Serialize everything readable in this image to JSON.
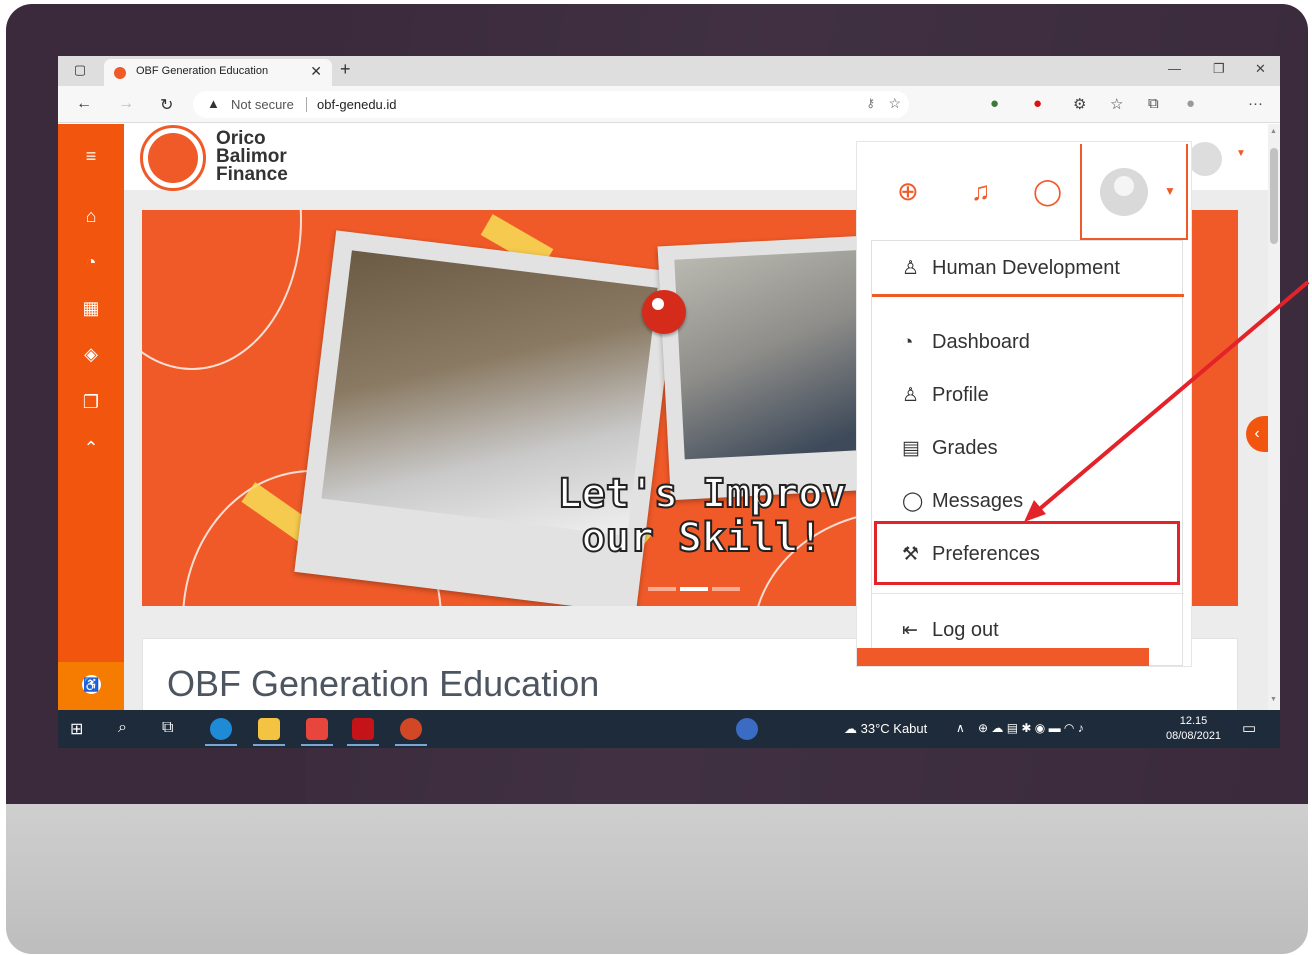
{
  "browser": {
    "tab_title": "OBF Generation Education",
    "not_secure": "Not secure",
    "url": "obf-genedu.id"
  },
  "site": {
    "logo_line1": "Orico",
    "logo_line2": "Balimor",
    "logo_line3": "Finance",
    "banner_line1": "Let's Improv",
    "banner_line2": "our Skill!",
    "course_title": "OBF Generation Education"
  },
  "user_menu": {
    "username": "Human Development",
    "items": [
      {
        "label": "Dashboard",
        "icon": "dashboard-icon"
      },
      {
        "label": "Profile",
        "icon": "profile-icon"
      },
      {
        "label": "Grades",
        "icon": "grades-icon"
      },
      {
        "label": "Messages",
        "icon": "messages-icon"
      },
      {
        "label": "Preferences",
        "icon": "wrench-icon"
      },
      {
        "label": "Log out",
        "icon": "logout-icon"
      }
    ],
    "highlighted": "Preferences"
  },
  "taskbar": {
    "weather": "33°C Kabut",
    "time": "12.15",
    "date": "08/08/2021"
  },
  "colors": {
    "brand": "#f05a28",
    "highlight": "#e3222a",
    "taskbar": "#1e2b3a"
  }
}
